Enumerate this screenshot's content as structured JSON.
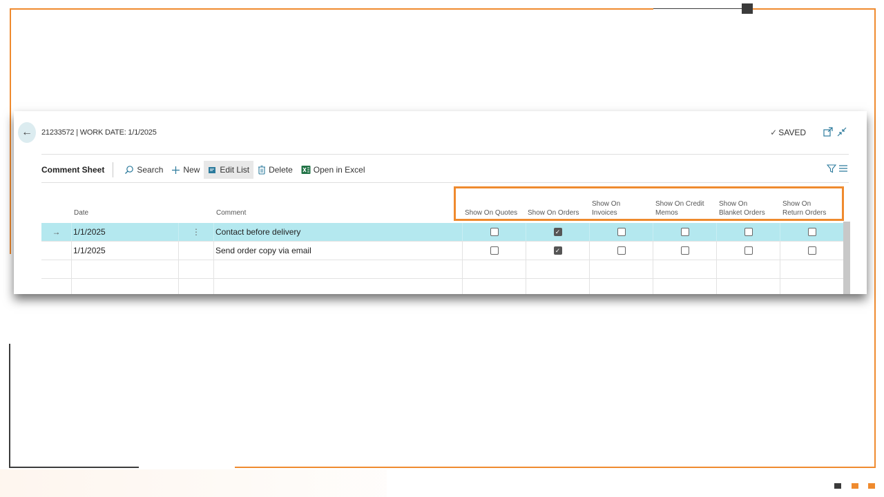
{
  "header": {
    "title": "21233572 | WORK DATE: 1/1/2025",
    "saved_label": "SAVED"
  },
  "actionbar": {
    "caption": "Comment Sheet",
    "search": "Search",
    "new": "New",
    "edit_list": "Edit List",
    "delete": "Delete",
    "open_excel": "Open in Excel"
  },
  "columns": {
    "date": "Date",
    "comment": "Comment",
    "quotes": "Show On Quotes",
    "orders": "Show On Orders",
    "invoices": "Show On Invoices",
    "credit_memos": "Show On Credit Memos",
    "blanket_orders": "Show On Blanket Orders",
    "return_orders": "Show On Return Orders"
  },
  "rows": [
    {
      "date": "1/1/2025",
      "comment": "Contact before delivery",
      "quotes": false,
      "orders": true,
      "invoices": false,
      "credit_memos": false,
      "blanket_orders": false,
      "return_orders": false,
      "selected": true
    },
    {
      "date": "1/1/2025",
      "comment": "Send order copy via email",
      "quotes": false,
      "orders": true,
      "invoices": false,
      "credit_memos": false,
      "blanket_orders": false,
      "return_orders": false,
      "selected": false
    }
  ],
  "colors": {
    "accent": "#ef8a2e",
    "selected_row": "#b4e8ef",
    "dark": "#3b3b3b"
  }
}
